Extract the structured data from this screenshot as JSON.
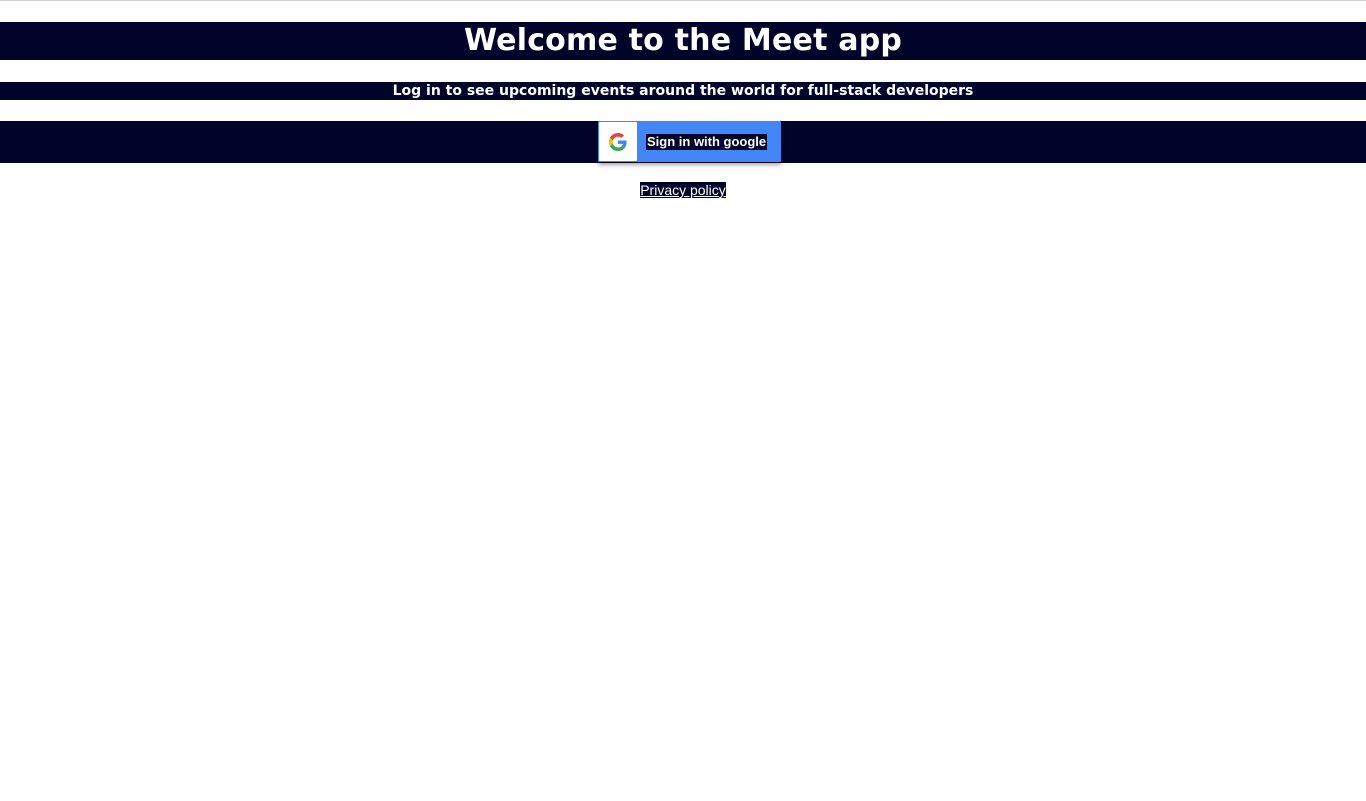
{
  "header": {
    "title": "Welcome to the Meet app",
    "subtitle": "Log in to see upcoming events around the world for full-stack developers"
  },
  "signin": {
    "button_label": "Sign in with google",
    "icon": "google-g-logo-icon",
    "button_color": "#4285f4"
  },
  "footer": {
    "privacy_label": "Privacy policy"
  },
  "colors": {
    "band": "#000429",
    "text": "#ffffff",
    "background": "#ffffff"
  }
}
